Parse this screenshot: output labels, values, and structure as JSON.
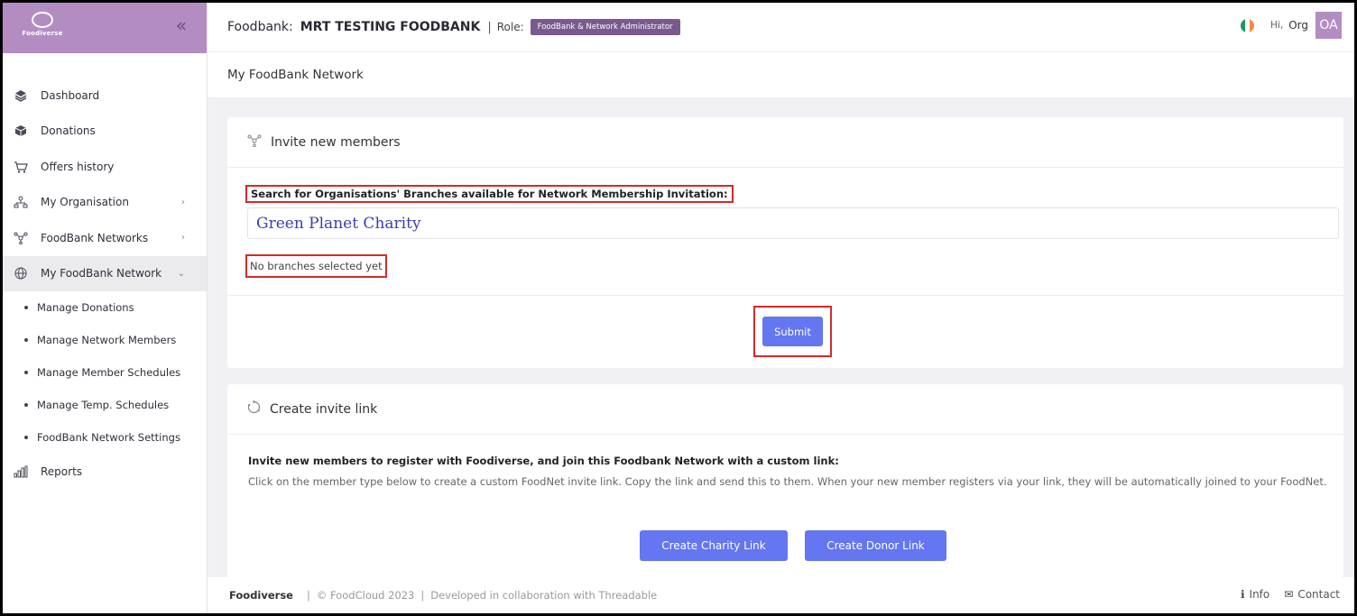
{
  "sidebar": {
    "logo_text": "Foodiverse",
    "collapse_icon": "«",
    "items": [
      {
        "label": "Dashboard",
        "icon": "layers-icon"
      },
      {
        "label": "Donations",
        "icon": "box-icon"
      },
      {
        "label": "Offers history",
        "icon": "cart-icon"
      },
      {
        "label": "My Organisation",
        "icon": "org-chart-icon",
        "arrow": "›"
      },
      {
        "label": "FoodBank Networks",
        "icon": "network-icon",
        "arrow": "›"
      },
      {
        "label": "My FoodBank Network",
        "icon": "globe-icon",
        "arrow": "⌄"
      }
    ],
    "sub_items": [
      {
        "label": "Manage Donations"
      },
      {
        "label": "Manage Network Members"
      },
      {
        "label": "Manage Member Schedules"
      },
      {
        "label": "Manage Temp. Schedules"
      },
      {
        "label": "FoodBank Network Settings"
      }
    ],
    "reports": {
      "label": "Reports",
      "icon": "bar-chart-icon"
    }
  },
  "header": {
    "foodbank_label": "Foodbank:",
    "foodbank_name": "MRT TESTING FOODBANK",
    "separator": "|",
    "role_label": "Role:",
    "role_badge": "FoodBank & Network Administrator",
    "greeting": "Hi,",
    "user": "Org",
    "avatar": "OA",
    "flag_colors": [
      "#169b62",
      "#ffffff",
      "#ff883e"
    ]
  },
  "page": {
    "title": "My FoodBank Network"
  },
  "invite_members": {
    "title": "Invite new members",
    "search_label": "Search for Organisations' Branches available for Network Membership Invitation:",
    "search_value": "Green Planet Charity",
    "no_branches": "No branches selected yet",
    "submit": "Submit"
  },
  "invite_link": {
    "title": "Create invite link",
    "heading": "Invite new members to register with Foodiverse, and join this Foodbank Network with a custom link:",
    "description": "Click on the member type below to create a custom FoodNet invite link. Copy the link and send this to them. When your new member registers via your link, they will be automatically joined to your FoodNet.",
    "charity_button": "Create Charity Link",
    "donor_button": "Create Donor Link"
  },
  "footer": {
    "brand": "Foodiverse",
    "copyright": "© FoodCloud 2023",
    "collab": "Developed in collaboration with Threadable",
    "info": "Info",
    "contact": "Contact"
  },
  "colors": {
    "brand": "#b38dc2",
    "accent": "#6476f0",
    "highlight": "#d32a2a"
  }
}
